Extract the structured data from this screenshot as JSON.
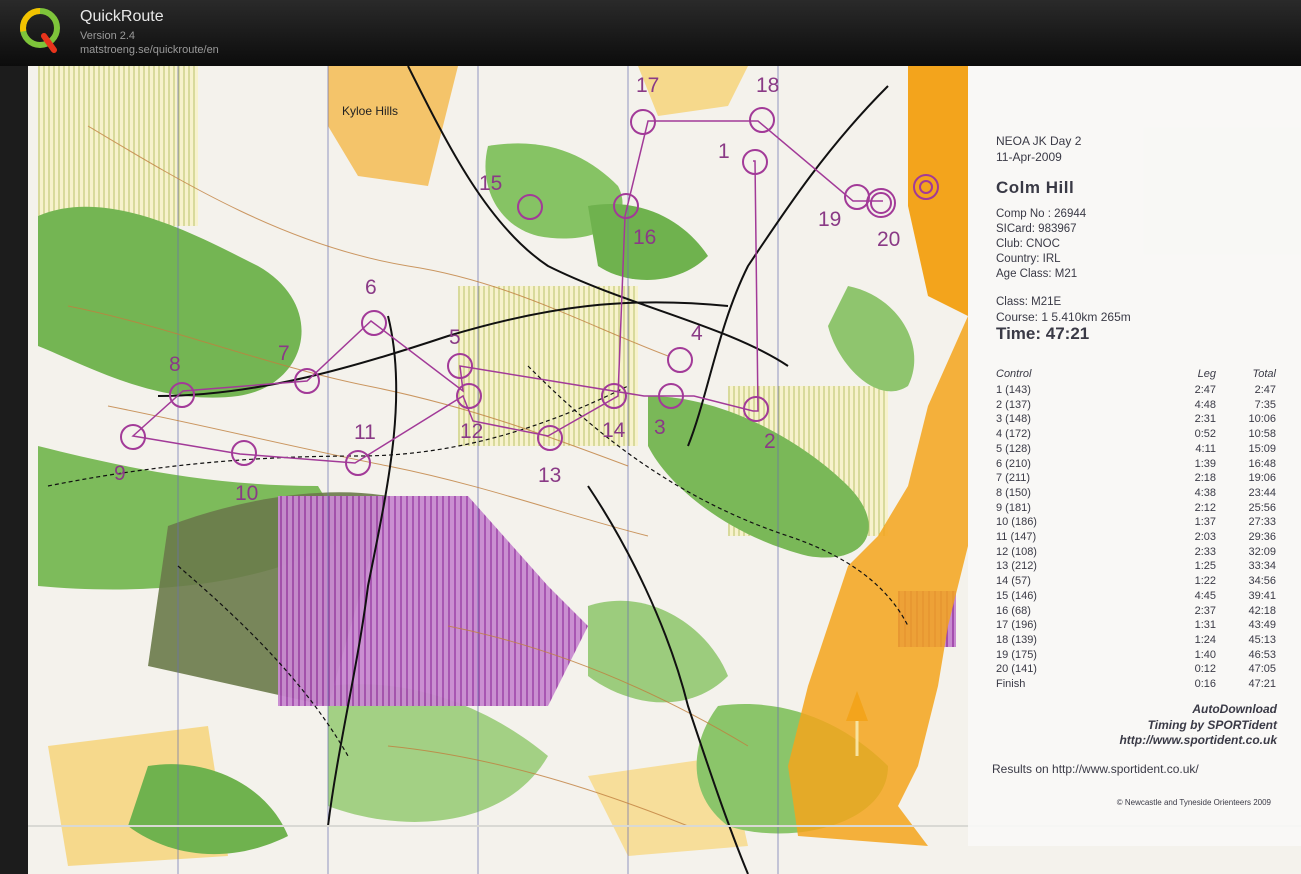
{
  "app": {
    "name": "QuickRoute",
    "version": "Version 2.4",
    "url": "matstroeng.se/quickroute/en",
    "logo_letter": "Q"
  },
  "map": {
    "place_label": "Kyloe Hills",
    "control_labels": [
      "1",
      "2",
      "3",
      "4",
      "5",
      "6",
      "7",
      "8",
      "9",
      "10",
      "11",
      "12",
      "13",
      "14",
      "15",
      "16",
      "17",
      "18",
      "19",
      "20"
    ],
    "colors": {
      "course": "#a23a98",
      "forest_green": "#6fb24e",
      "open_yellow": "#f5c96a",
      "restricted_purple": "#b04fb4",
      "boundary_orange": "#f3a41c"
    }
  },
  "panel": {
    "race": "NEOA JK Day 2",
    "date": "11-Apr-2009",
    "course_name": "Colm Hill",
    "info": [
      "Comp No  : 26944",
      "SICard: 983967",
      "Club:  CNOC",
      "Country: IRL",
      "Age Class:  M21"
    ],
    "class": "Class:  M21E",
    "course": "Course: 1 5.410km 265m",
    "time": "Time:  47:21",
    "headers": {
      "control": "Control",
      "leg": "Leg",
      "total": "Total"
    },
    "splits": [
      {
        "control": "1 (143)",
        "leg": "2:47",
        "total": "2:47"
      },
      {
        "control": "2 (137)",
        "leg": "4:48",
        "total": "7:35"
      },
      {
        "control": "3 (148)",
        "leg": "2:31",
        "total": "10:06"
      },
      {
        "control": "4 (172)",
        "leg": "0:52",
        "total": "10:58"
      },
      {
        "control": "5 (128)",
        "leg": "4:11",
        "total": "15:09"
      },
      {
        "control": "6 (210)",
        "leg": "1:39",
        "total": "16:48"
      },
      {
        "control": "7 (211)",
        "leg": "2:18",
        "total": "19:06"
      },
      {
        "control": "8 (150)",
        "leg": "4:38",
        "total": "23:44"
      },
      {
        "control": "9 (181)",
        "leg": "2:12",
        "total": "25:56"
      },
      {
        "control": "10 (186)",
        "leg": "1:37",
        "total": "27:33"
      },
      {
        "control": "11 (147)",
        "leg": "2:03",
        "total": "29:36"
      },
      {
        "control": "12 (108)",
        "leg": "2:33",
        "total": "32:09"
      },
      {
        "control": "13 (212)",
        "leg": "1:25",
        "total": "33:34"
      },
      {
        "control": "14 (57)",
        "leg": "1:22",
        "total": "34:56"
      },
      {
        "control": "15 (146)",
        "leg": "4:45",
        "total": "39:41"
      },
      {
        "control": "16 (68)",
        "leg": "2:37",
        "total": "42:18"
      },
      {
        "control": "17 (196)",
        "leg": "1:31",
        "total": "43:49"
      },
      {
        "control": "18 (139)",
        "leg": "1:24",
        "total": "45:13"
      },
      {
        "control": "19 (175)",
        "leg": "1:40",
        "total": "46:53"
      },
      {
        "control": "20 (141)",
        "leg": "0:12",
        "total": "47:05"
      },
      {
        "control": "Finish",
        "leg": "0:16",
        "total": "47:21"
      }
    ],
    "autodownload": "AutoDownload",
    "timing": "Timing by SPORTident",
    "sportident_url": "http://www.sportident.co.uk",
    "results": "Results  on  http://www.sportident.co.uk/",
    "copyright": "© Newcastle and Tyneside Orienteers 2009"
  }
}
